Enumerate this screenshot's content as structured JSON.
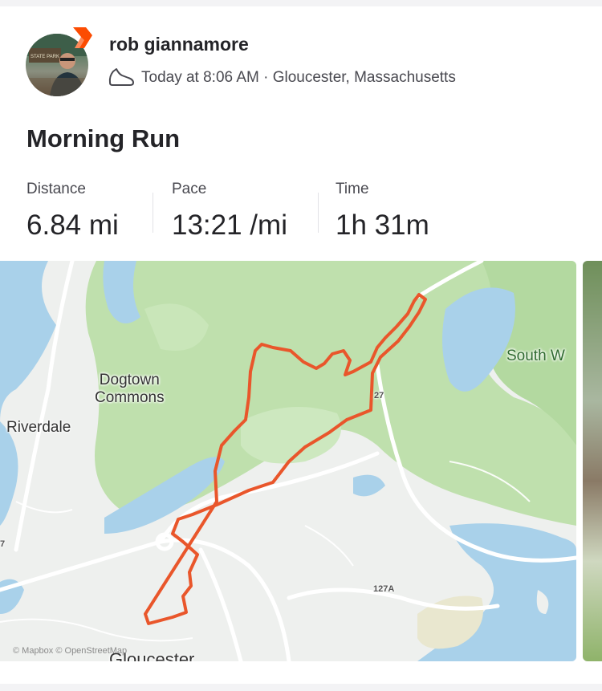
{
  "athlete": {
    "name": "rob giannamore",
    "avatar_sign_text": "STATE PARK"
  },
  "activity": {
    "timestamp": "Today at 8:06 AM",
    "location": "Gloucester, Massachusetts",
    "meta_separator": " · ",
    "title": "Morning Run",
    "sport_icon": "running-shoe-icon"
  },
  "stats": [
    {
      "label": "Distance",
      "value": "6.84 mi"
    },
    {
      "label": "Pace",
      "value": "13:21 /mi"
    },
    {
      "label": "Time",
      "value": "1h 31m"
    }
  ],
  "map": {
    "labels": {
      "dogtown": "Dogtown\nCommons",
      "riverdale": "Riverdale",
      "south": "South W",
      "gloucester": "Gloucester"
    },
    "road_badges": {
      "r27": "27",
      "r127a": "127A",
      "r7": "7"
    },
    "attribution": "© Mapbox  © OpenStreetMap",
    "route_color": "#e9562b"
  },
  "colors": {
    "accent": "#fc4c02",
    "water": "#a9d1ea",
    "park": "#bfe0ad"
  }
}
